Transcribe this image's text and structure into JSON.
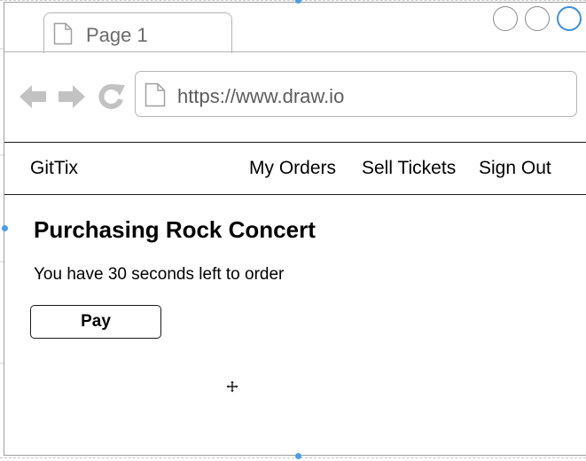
{
  "browser": {
    "tab_title": "Page 1",
    "url": "https://www.draw.io",
    "accent_color": "#3d8fe0",
    "icons": {
      "tab": "document-icon",
      "back": "back-arrow-icon",
      "forward": "forward-arrow-icon",
      "reload": "reload-icon",
      "url": "document-icon"
    }
  },
  "app": {
    "brand": "GitTix",
    "nav_links": [
      "My Orders",
      "Sell Tickets",
      "Sign Out"
    ]
  },
  "content": {
    "heading": "Purchasing Rock Concert",
    "timer_text": "You have 30 seconds left to order",
    "pay_label": "Pay"
  },
  "editor": {
    "selection_color": "#4a9ee8",
    "cursor_icon": "move-cursor-icon"
  }
}
